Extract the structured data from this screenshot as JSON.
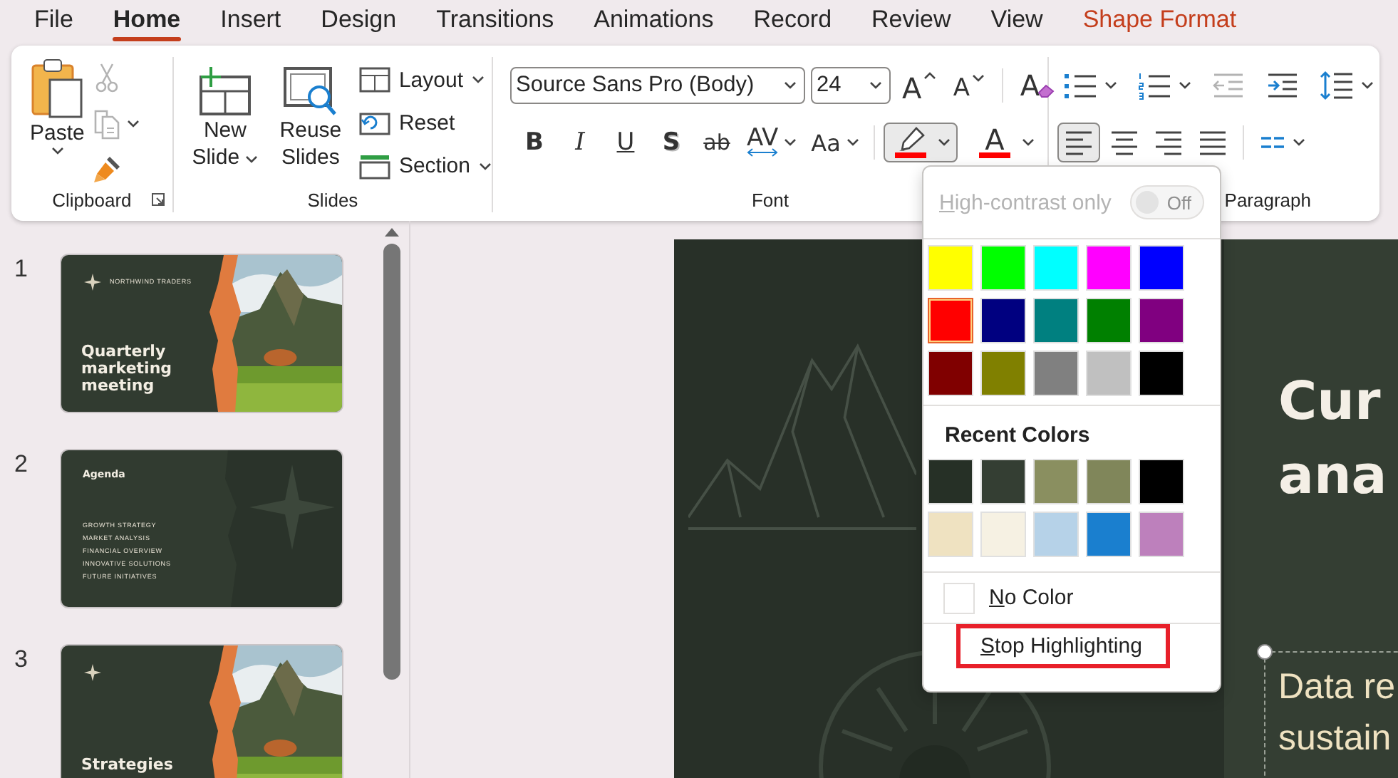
{
  "tabs": [
    {
      "label": "File",
      "selected": false,
      "contextual": false
    },
    {
      "label": "Home",
      "selected": true,
      "contextual": false
    },
    {
      "label": "Insert",
      "selected": false,
      "contextual": false
    },
    {
      "label": "Design",
      "selected": false,
      "contextual": false
    },
    {
      "label": "Transitions",
      "selected": false,
      "contextual": false
    },
    {
      "label": "Animations",
      "selected": false,
      "contextual": false
    },
    {
      "label": "Record",
      "selected": false,
      "contextual": false
    },
    {
      "label": "Review",
      "selected": false,
      "contextual": false
    },
    {
      "label": "View",
      "selected": false,
      "contextual": false
    },
    {
      "label": "Shape Format",
      "selected": false,
      "contextual": true
    }
  ],
  "ribbon": {
    "clipboard": {
      "paste": "Paste",
      "tools": [
        {
          "kind": "cut",
          "disabled": true
        },
        {
          "kind": "copy",
          "disabled": true
        },
        {
          "kind": "format-painter",
          "disabled": false
        }
      ],
      "label": "Clipboard"
    },
    "slides": {
      "new_slide": "New Slide",
      "reuse_slides": "Reuse Slides",
      "layout": "Layout",
      "reset": "Reset",
      "section": "Section",
      "label": "Slides"
    },
    "font": {
      "font_name": "Source Sans Pro (Body)",
      "font_size": "24",
      "grow": "A",
      "shrink": "A",
      "clear": "A",
      "format_buttons": [
        {
          "kind": "bold",
          "label": "B"
        },
        {
          "kind": "italic",
          "label": "I"
        },
        {
          "kind": "underline",
          "label": "U"
        },
        {
          "kind": "shadow",
          "label": "S"
        },
        {
          "kind": "strikethrough",
          "label": "ab"
        },
        {
          "kind": "spacing",
          "label": "AV"
        },
        {
          "kind": "case",
          "label": "Aa"
        }
      ],
      "highlight": {
        "color": "#ff0000",
        "open": true
      },
      "font_color": {
        "label": "A",
        "color": "#ff0000"
      },
      "label": "Font"
    },
    "paragraph": {
      "list_tools": [
        {
          "kind": "bullets",
          "disabled": false
        },
        {
          "kind": "numbering",
          "disabled": false
        },
        {
          "kind": "decrease-indent",
          "disabled": true
        },
        {
          "kind": "increase-indent",
          "disabled": false
        },
        {
          "kind": "line-spacing",
          "disabled": false
        }
      ],
      "align": [
        {
          "kind": "left",
          "selected": true
        },
        {
          "kind": "center",
          "selected": false
        },
        {
          "kind": "right",
          "selected": false
        },
        {
          "kind": "justify",
          "selected": false
        }
      ],
      "label": "Paragraph"
    }
  },
  "slides": [
    {
      "number": "1",
      "kind": "title-photo",
      "brand": "NORTHWIND TRADERS",
      "title": "Quarterly marketing meeting"
    },
    {
      "number": "2",
      "kind": "agenda",
      "title": "Agenda",
      "items": [
        "GROWTH STRATEGY",
        "MARKET ANALYSIS",
        "FINANCIAL OVERVIEW",
        "INNOVATIVE SOLUTIONS",
        "FUTURE INITIATIVES"
      ]
    },
    {
      "number": "3",
      "kind": "title-photo",
      "title": "Strategies"
    }
  ],
  "editor": {
    "title_lines": [
      "Cur",
      "ana"
    ],
    "body_lines": [
      "Data re",
      "sustain"
    ],
    "body_selected": true
  },
  "popup": {
    "high_contrast": {
      "label": "High-contrast only",
      "on": false,
      "state_label": "Off",
      "disabled": true
    },
    "standard_colors": [
      {
        "color": "#ffff00",
        "selected": false
      },
      {
        "color": "#00ff00",
        "selected": false
      },
      {
        "color": "#00ffff",
        "selected": false
      },
      {
        "color": "#ff00ff",
        "selected": false
      },
      {
        "color": "#0000ff",
        "selected": false
      },
      {
        "color": "#ff0000",
        "selected": true
      },
      {
        "color": "#000080",
        "selected": false
      },
      {
        "color": "#008080",
        "selected": false
      },
      {
        "color": "#008000",
        "selected": false
      },
      {
        "color": "#800080",
        "selected": false
      },
      {
        "color": "#800000",
        "selected": false
      },
      {
        "color": "#808000",
        "selected": false
      },
      {
        "color": "#808080",
        "selected": false
      },
      {
        "color": "#c0c0c0",
        "selected": false
      },
      {
        "color": "#000000",
        "selected": false
      }
    ],
    "recent_title": "Recent Colors",
    "recent_colors": [
      {
        "color": "#263026"
      },
      {
        "color": "#343e33"
      },
      {
        "color": "#8a8f60"
      },
      {
        "color": "#80865a"
      },
      {
        "color": "#000000"
      },
      {
        "color": "#efe2c1"
      },
      {
        "color": "#f6f1e3"
      },
      {
        "color": "#b6d2e8"
      },
      {
        "color": "#1a7fcf"
      },
      {
        "color": "#bd80bc"
      }
    ],
    "no_color": "No Color",
    "stop_highlighting": {
      "label": "Stop Highlighting",
      "highlighted": true
    }
  }
}
